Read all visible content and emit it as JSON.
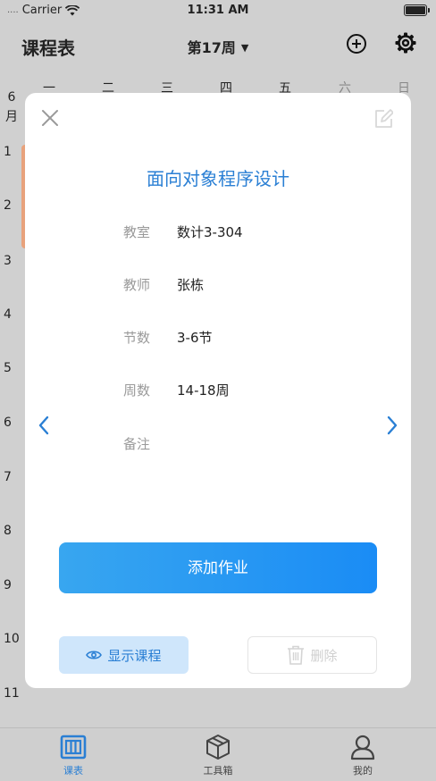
{
  "status_bar": {
    "dots": "....",
    "carrier": "Carrier",
    "time": "11:31 AM"
  },
  "nav": {
    "title": "课程表",
    "week": "第17周"
  },
  "week_header": {
    "month_num": "6",
    "month_unit": "月",
    "days": [
      "一",
      "二",
      "三",
      "四",
      "五",
      "六",
      "日"
    ]
  },
  "periods": [
    "1",
    "2",
    "3",
    "4",
    "5",
    "6",
    "7",
    "8",
    "9",
    "10",
    "11"
  ],
  "modal": {
    "course_name": "面向对象程序设计",
    "rows": [
      {
        "label": "教室",
        "value": "数计3-304"
      },
      {
        "label": "教师",
        "value": "张栋"
      },
      {
        "label": "节数",
        "value": "3-6节"
      },
      {
        "label": "周数",
        "value": "14-18周"
      },
      {
        "label": "备注",
        "value": ""
      }
    ],
    "add_homework": "添加作业",
    "show_course": "显示课程",
    "delete": "删除"
  },
  "tabs": [
    {
      "label": "课表",
      "icon": "schedule-icon",
      "active": true
    },
    {
      "label": "工具箱",
      "icon": "toolbox-icon",
      "active": false
    },
    {
      "label": "我的",
      "icon": "profile-icon",
      "active": false
    }
  ],
  "colors": {
    "accent": "#2a7fd4",
    "course_block": "#e8a27c"
  }
}
